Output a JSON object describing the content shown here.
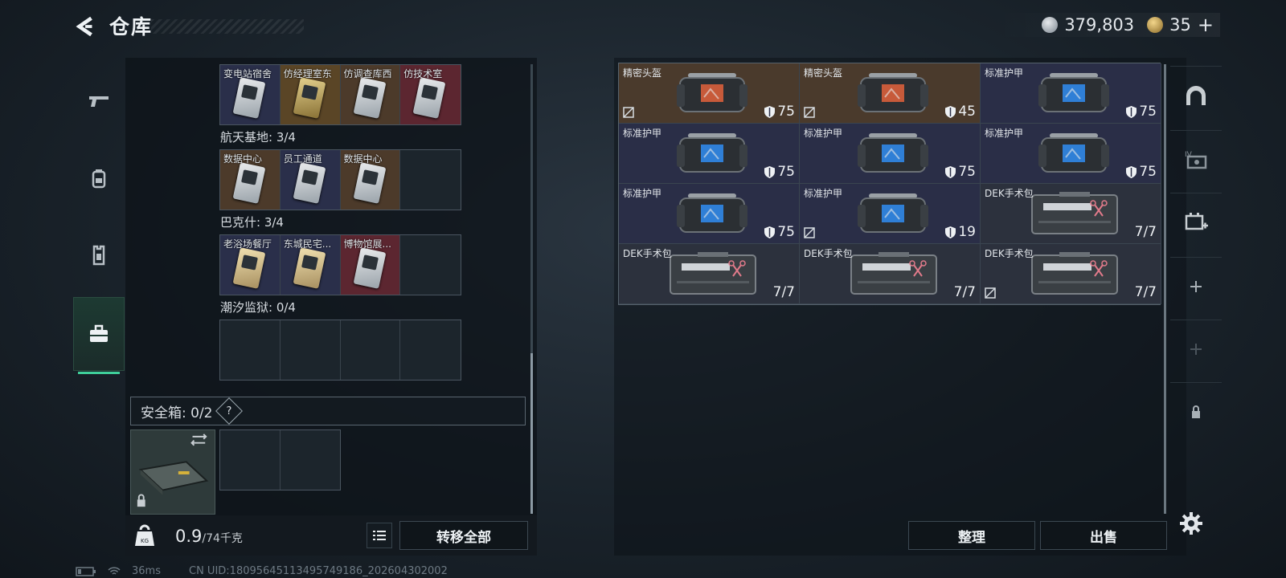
{
  "header": {
    "title": "仓库",
    "currency_1": "379,803",
    "currency_2": "35",
    "add_symbol": "+"
  },
  "left_nav": {
    "tabs": [
      "weapon-icon",
      "backpack-icon",
      "armor-vest-icon",
      "toolbox-icon"
    ],
    "active_index": 3
  },
  "keycard_groups": [
    {
      "label": "",
      "cards": [
        {
          "name": "变电站宿舍",
          "rarity": "navy"
        },
        {
          "name": "仿经理室东",
          "rarity": "gold"
        },
        {
          "name": "仿调查库西",
          "rarity": "brown"
        },
        {
          "name": "仿技术室",
          "rarity": "red"
        }
      ]
    },
    {
      "label": "航天基地: 3/4",
      "cards": [
        {
          "name": "数据中心",
          "rarity": "brown"
        },
        {
          "name": "员工通道",
          "rarity": "navy"
        },
        {
          "name": "数据中心",
          "rarity": "brown"
        }
      ]
    },
    {
      "label": "巴克什: 3/4",
      "cards": [
        {
          "name": "老浴场餐厅",
          "rarity": "navy"
        },
        {
          "name": "东城民宅...",
          "rarity": "navy"
        },
        {
          "name": "博物馆展...",
          "rarity": "red"
        }
      ]
    },
    {
      "label": "潮汐监狱: 0/4",
      "cards": []
    }
  ],
  "safebox": {
    "label": "安全箱: 0/2",
    "help": "?"
  },
  "weight": {
    "current": "0.9",
    "max": "/74千克"
  },
  "buttons": {
    "transfer_all": "转移全部",
    "sort": "整理",
    "sell": "出售"
  },
  "items": [
    {
      "name": "精密头盔",
      "value": "75",
      "rarity": "brown",
      "kind": "helmet",
      "insured": false
    },
    {
      "name": "精密头盔",
      "value": "45",
      "rarity": "brown",
      "kind": "helmet",
      "insured": false
    },
    {
      "name": "标准护甲",
      "value": "75",
      "rarity": "navy",
      "kind": "armor",
      "insured": true
    },
    {
      "name": "标准护甲",
      "value": "75",
      "rarity": "navy",
      "kind": "armor",
      "insured": true
    },
    {
      "name": "标准护甲",
      "value": "75",
      "rarity": "navy",
      "kind": "armor",
      "insured": true
    },
    {
      "name": "标准护甲",
      "value": "75",
      "rarity": "navy",
      "kind": "armor",
      "insured": true
    },
    {
      "name": "标准护甲",
      "value": "75",
      "rarity": "navy",
      "kind": "armor",
      "insured": true
    },
    {
      "name": "标准护甲",
      "value": "19",
      "rarity": "navy",
      "kind": "armor",
      "insured": false
    },
    {
      "name": "DEK手术包",
      "value": "7/7",
      "rarity": "gray",
      "kind": "medkit",
      "insured": true
    },
    {
      "name": "DEK手术包",
      "value": "7/7",
      "rarity": "gray",
      "kind": "medkit",
      "insured": true
    },
    {
      "name": "DEK手术包",
      "value": "7/7",
      "rarity": "gray",
      "kind": "medkit",
      "insured": true
    },
    {
      "name": "DEK手术包",
      "value": "7/7",
      "rarity": "gray",
      "kind": "medkit",
      "insured": false
    }
  ],
  "right_tabs": [
    "storage-dome-icon",
    "card-slot-iv-icon",
    "add-container-icon",
    "plus-icon",
    "plus-icon",
    "lock-icon"
  ],
  "status": {
    "ping": "36ms",
    "uid": "CN UID:18095645113495749186_202604302002"
  },
  "colors": {
    "accent": "#3fd09a",
    "rarity_brown": "#4a3a2c",
    "rarity_navy": "#2a2e47",
    "rarity_red": "#5c2630",
    "rarity_gold": "#5a4526"
  }
}
